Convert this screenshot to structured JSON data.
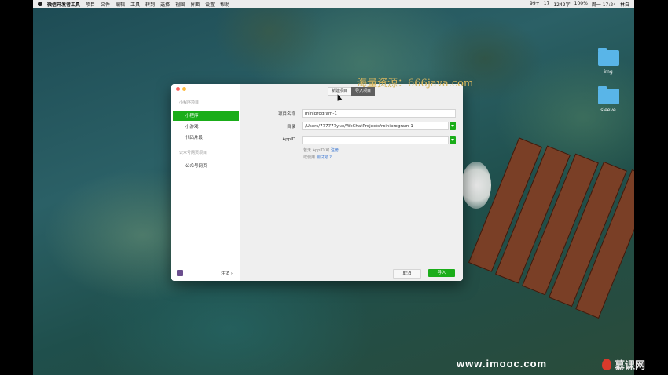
{
  "menubar": {
    "app_name": "微信开发者工具",
    "items": [
      "项目",
      "文件",
      "编辑",
      "工具",
      "转到",
      "选择",
      "视图",
      "界面",
      "设置",
      "帮助"
    ],
    "status": [
      "99+",
      "17",
      "1242字",
      "100%",
      "周一 17:24",
      "林白"
    ]
  },
  "desktop": {
    "icons": [
      {
        "label": "img",
        "icon": "folder-icon"
      },
      {
        "label": "sleeve",
        "icon": "folder-icon"
      }
    ]
  },
  "window": {
    "sidebar": {
      "section_miniprogram": "小程序项目",
      "items_miniprogram": [
        "小程序",
        "小游戏",
        "代码片段"
      ],
      "section_official": "公众号网页项目",
      "items_official": [
        "公众号网页"
      ],
      "logout_label": "注销 ›"
    },
    "tabs": [
      "新建项目",
      "导入项目"
    ],
    "form": {
      "project_name_label": "项目名称",
      "project_name_value": "miniprogram-1",
      "directory_label": "目录",
      "directory_value": "/Users/777777yue/WeChatProjects/miniprogram-1",
      "appid_label": "AppID",
      "appid_value": "",
      "hint_line1_prefix": "若无 AppID 可",
      "hint_line1_link": "注册",
      "hint_line2_prefix": "或使用",
      "hint_line2_link": "测试号",
      "hint_help": "?"
    },
    "buttons": {
      "cancel": "取消",
      "import": "导入"
    }
  },
  "overlay": {
    "watermark": "海量资源：666java.com",
    "site": "www.imooc.com",
    "brand": "慕课网"
  },
  "colors": {
    "accent": "#1aad19",
    "link": "#2f6fd0",
    "close_dot": "#fc605b",
    "minimize_dot": "#fdbc40"
  }
}
